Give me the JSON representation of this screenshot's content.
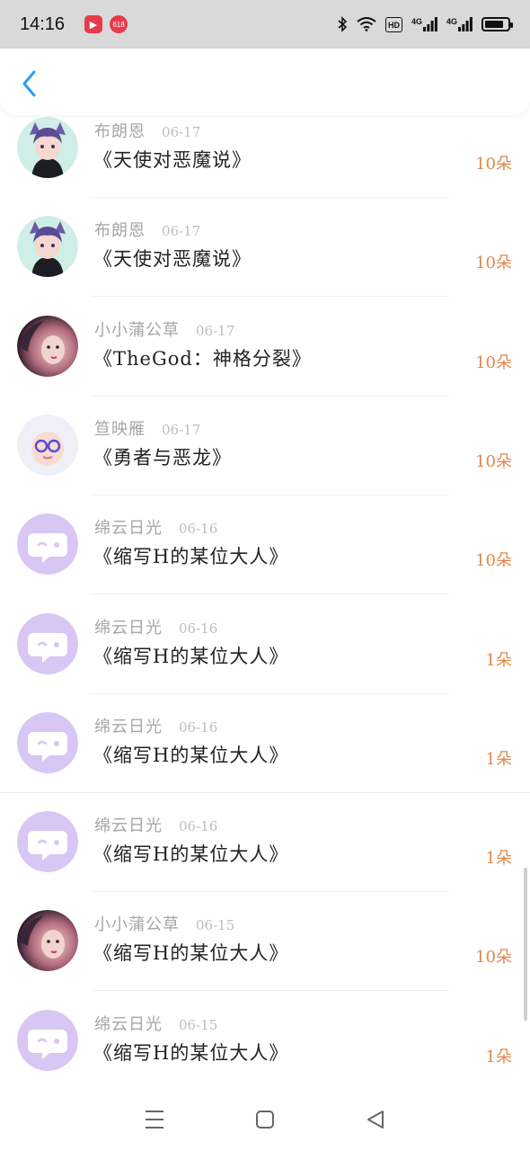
{
  "status_bar": {
    "time": "14:16",
    "icons": [
      "video-app-icon",
      "shopping-app-icon",
      "bluetooth-icon",
      "wifi-icon",
      "hd-icon",
      "signal-4g-icon",
      "signal-4g-icon",
      "battery-icon"
    ],
    "net_labels": [
      "HD",
      "4G",
      "4G"
    ],
    "battery_level": 0.85
  },
  "header": {
    "back_icon": "chevron-left-icon",
    "accent": "#2b9df0"
  },
  "colors": {
    "name": "#a6a6a6",
    "date": "#bdbdbd",
    "count": "#e0884a",
    "bubble_avatar": "#d8c6f4"
  },
  "rows": [
    {
      "name": "布朗恩",
      "date": "06-17",
      "title": "《天使对恶魔说》",
      "count": "10朵",
      "avatar": "catgirl-avatar"
    },
    {
      "name": "布朗恩",
      "date": "06-17",
      "title": "《天使对恶魔说》",
      "count": "10朵",
      "avatar": "catgirl-avatar"
    },
    {
      "name": "小小蒲公草",
      "date": "06-17",
      "title": "《TheGod：神格分裂》",
      "count": "10朵",
      "avatar": "girl-photo-avatar"
    },
    {
      "name": "笪映雁",
      "date": "06-17",
      "title": "《勇者与恶龙》",
      "count": "10朵",
      "avatar": "baby-glasses-avatar"
    },
    {
      "name": "绵云日光",
      "date": "06-16",
      "title": "《缩写H的某位大人》",
      "count": "10朵",
      "avatar": "chat-bubble-avatar"
    },
    {
      "name": "绵云日光",
      "date": "06-16",
      "title": "《缩写H的某位大人》",
      "count": "1朵",
      "avatar": "chat-bubble-avatar"
    },
    {
      "name": "绵云日光",
      "date": "06-16",
      "title": "《缩写H的某位大人》",
      "count": "1朵",
      "avatar": "chat-bubble-avatar"
    },
    {
      "name": "绵云日光",
      "date": "06-16",
      "title": "《缩写H的某位大人》",
      "count": "1朵",
      "avatar": "chat-bubble-avatar"
    },
    {
      "name": "小小蒲公草",
      "date": "06-15",
      "title": "《缩写H的某位大人》",
      "count": "10朵",
      "avatar": "girl-photo-avatar"
    },
    {
      "name": "绵云日光",
      "date": "06-15",
      "title": "《缩写H的某位大人》",
      "count": "1朵",
      "avatar": "chat-bubble-avatar"
    }
  ],
  "nav_bar": {
    "icons": [
      "menu-icon",
      "home-square-icon",
      "back-triangle-icon"
    ]
  }
}
